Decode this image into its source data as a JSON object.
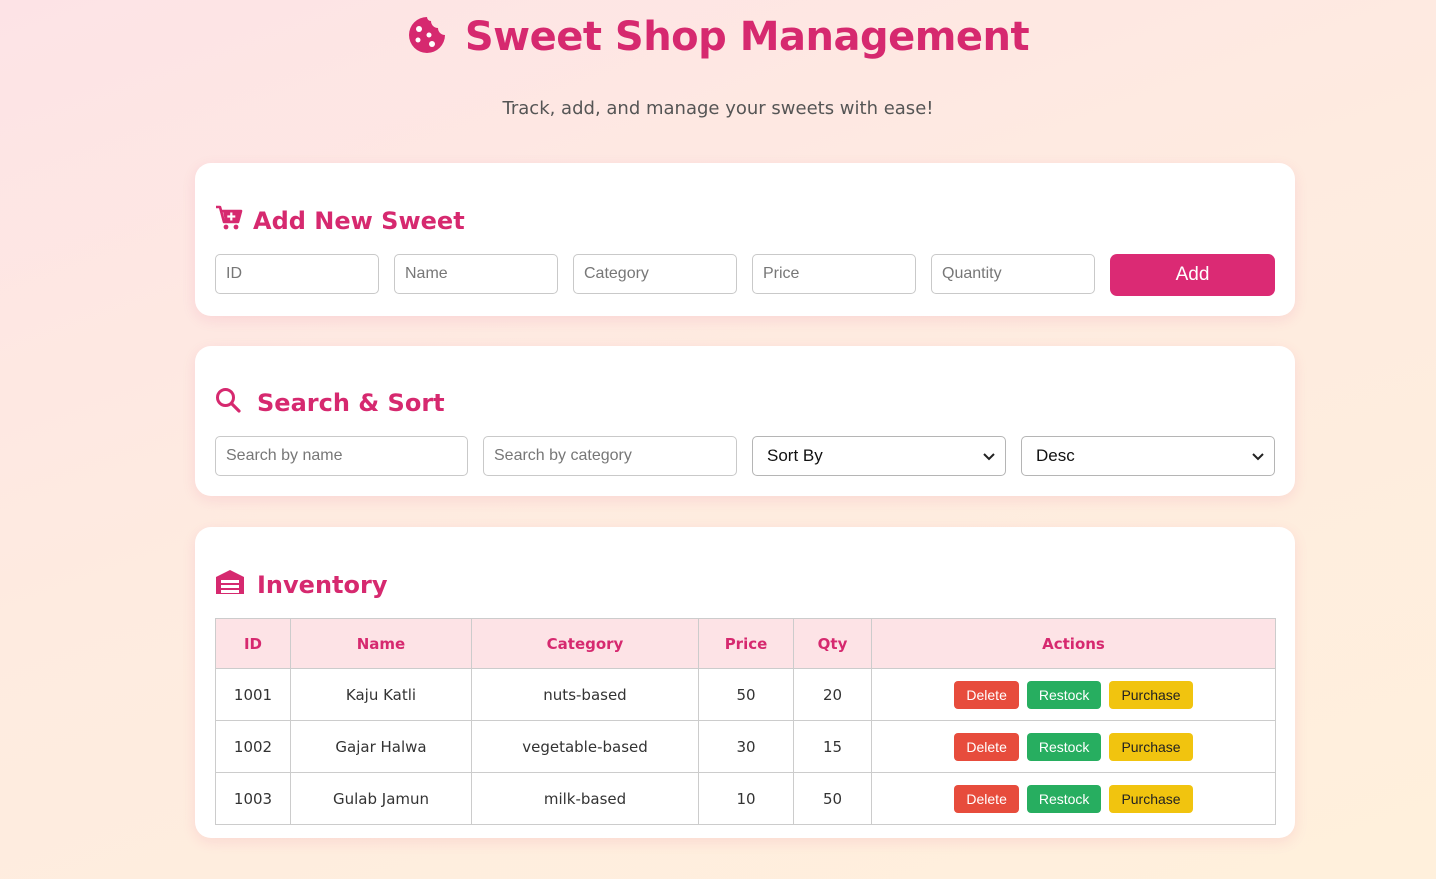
{
  "header": {
    "title": "Sweet Shop Management",
    "subtitle": "Track, add, and manage your sweets with ease!",
    "icon": "cookie-icon",
    "accent": "#d6296f"
  },
  "add_section": {
    "title": "Add New Sweet",
    "icon": "cart-plus-icon",
    "fields": {
      "id": {
        "placeholder": "ID",
        "value": ""
      },
      "name": {
        "placeholder": "Name",
        "value": ""
      },
      "category": {
        "placeholder": "Category",
        "value": ""
      },
      "price": {
        "placeholder": "Price",
        "value": ""
      },
      "quantity": {
        "placeholder": "Quantity",
        "value": ""
      }
    },
    "add_label": "Add",
    "button_color": "#db2a74"
  },
  "search_section": {
    "title": "Search & Sort",
    "icon": "search-icon",
    "name_search": {
      "placeholder": "Search by name",
      "value": ""
    },
    "category_search": {
      "placeholder": "Search by category",
      "value": ""
    },
    "sort_by": {
      "selected": "Sort By"
    },
    "order": {
      "selected": "Desc"
    }
  },
  "inventory": {
    "title": "Inventory",
    "icon": "warehouse-icon",
    "columns": [
      "ID",
      "Name",
      "Category",
      "Price",
      "Qty",
      "Actions"
    ],
    "rows": [
      {
        "id": "1001",
        "name": "Kaju Katli",
        "category": "nuts-based",
        "price": "50",
        "qty": "20"
      },
      {
        "id": "1002",
        "name": "Gajar Halwa",
        "category": "vegetable-based",
        "price": "30",
        "qty": "15"
      },
      {
        "id": "1003",
        "name": "Gulab Jamun",
        "category": "milk-based",
        "price": "10",
        "qty": "50"
      }
    ],
    "actions": {
      "delete": "Delete",
      "restock": "Restock",
      "purchase": "Purchase"
    },
    "action_colors": {
      "delete": "#e74c3c",
      "restock": "#27ae60",
      "purchase": "#f1c40f"
    }
  }
}
